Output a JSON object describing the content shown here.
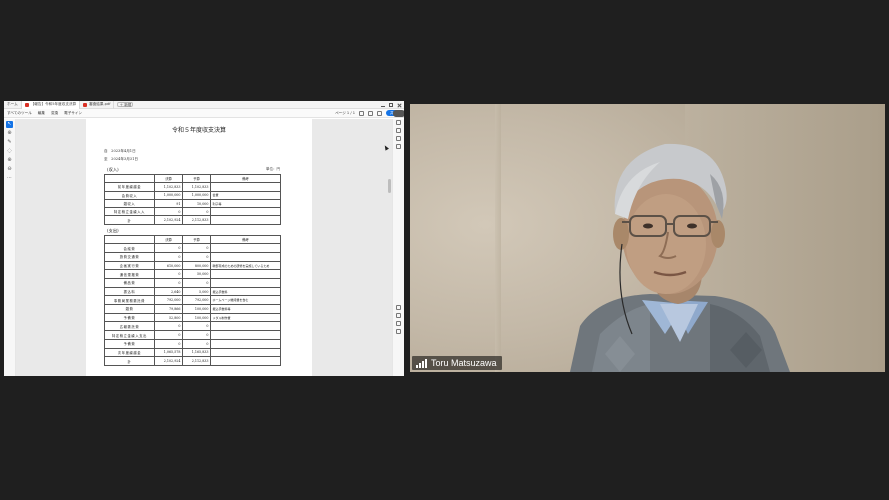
{
  "shared_window": {
    "tabs": [
      {
        "label": "ホーム",
        "active": false
      },
      {
        "label": "【報告】令和5年度収支決算",
        "active": true
      },
      {
        "label": "審査結果.pdf",
        "active": false
      }
    ],
    "new_tab_label": "＋ 新規",
    "menu": [
      "すべてのツール",
      "編集",
      "変換",
      "電子サイン"
    ],
    "toolbar_right_text": "ページ 1 / 1",
    "share_label": "共有"
  },
  "document": {
    "title": "令和５年度収支決算",
    "period_from": "自　2023年4月1日",
    "period_to": "至　2024年3月31日",
    "unit": "単位：円",
    "income_label": "(収入)",
    "expense_label": "(支出)",
    "income_headers": [
      "",
      "決算",
      "予算",
      "備考"
    ],
    "income_rows": [
      {
        "item": "前年度繰越金",
        "a": "1,102,833",
        "b": "1,102,833",
        "note": ""
      },
      {
        "item": "会費収入",
        "a": "1,000,000",
        "b": "1,000,000",
        "note": "会費"
      },
      {
        "item": "雑収入",
        "a": "91",
        "b": "10,000",
        "note": "利子等"
      },
      {
        "item": "特定積立金繰入入",
        "a": "0",
        "b": "0",
        "note": ""
      },
      {
        "item": "計",
        "a": "2,102,924",
        "b": "2,112,833",
        "note": ""
      }
    ],
    "expense_headers": [
      "",
      "決算",
      "予算",
      "備考"
    ],
    "expense_rows": [
      {
        "item": "会議費",
        "a": "0",
        "b": "0",
        "note": ""
      },
      {
        "item": "旅費交通費",
        "a": "0",
        "b": "0",
        "note": ""
      },
      {
        "item": "企画実行費",
        "a": "610,000",
        "b": "800,000",
        "note": "幹部育成のための研修を実施しているため"
      },
      {
        "item": "通信運搬費",
        "a": "0",
        "b": "50,000",
        "note": ""
      },
      {
        "item": "備品費",
        "a": "0",
        "b": "0",
        "note": ""
      },
      {
        "item": "振込料",
        "a": "2,640",
        "b": "5,000",
        "note": "振込手数料"
      },
      {
        "item": "事務局業務委託費",
        "a": "792,000",
        "b": "792,000",
        "note": "ホームページ維持費を含む"
      },
      {
        "item": "雑費",
        "a": "79,866",
        "b": "100,000",
        "note": "振込手数料等"
      },
      {
        "item": "予備費",
        "a": "52,800",
        "b": "100,000",
        "note": "メダル制作費"
      },
      {
        "item": "広報委託費",
        "a": "0",
        "b": "0",
        "note": ""
      },
      {
        "item": "特定積立金繰入支出",
        "a": "0",
        "b": "0",
        "note": ""
      },
      {
        "item": "予備費",
        "a": "0",
        "b": "0",
        "note": ""
      },
      {
        "item": "次年度繰越金",
        "a": "1,065,578",
        "b": "1,165,833",
        "note": ""
      },
      {
        "item": "計",
        "a": "2,102,924",
        "b": "2,112,833",
        "note": ""
      }
    ]
  },
  "participant": {
    "name": "Toru Matsuzawa"
  },
  "colors": {
    "meeting_bg": "#1f1f1f",
    "accent": "#1473e6"
  }
}
